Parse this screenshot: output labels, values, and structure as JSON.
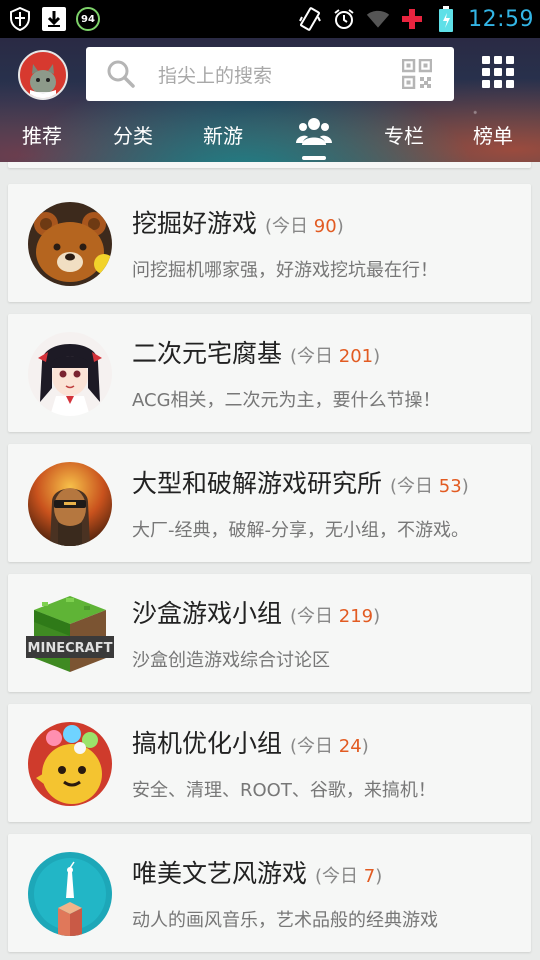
{
  "status_bar": {
    "time": "12:59",
    "notification_badge": "94",
    "icons": [
      "shield-icon",
      "download-icon",
      "badge-icon",
      "vibrate-icon",
      "alarm-icon",
      "wifi-icon",
      "plus-icon",
      "battery-icon"
    ]
  },
  "header": {
    "search_placeholder": "指尖上的搜索",
    "tabs": [
      {
        "label": "推荐"
      },
      {
        "label": "分类"
      },
      {
        "label": "新游"
      },
      {
        "label": "",
        "icon": "groups-icon",
        "active": true
      },
      {
        "label": "专栏"
      },
      {
        "label": "榜单"
      }
    ]
  },
  "groups": [
    {
      "name": "挖掘好游戏",
      "today_prefix": "(今日",
      "count": "90",
      "today_suffix": ")",
      "desc": "问挖掘机哪家强，好游戏挖坑最在行！",
      "icon": "bear-icon"
    },
    {
      "name": "二次元宅腐基",
      "today_prefix": "(今日",
      "count": "201",
      "today_suffix": ")",
      "desc": "ACG相关，二次元为主，要什么节操！",
      "icon": "anime-girl-icon"
    },
    {
      "name": "大型和破解游戏研究所",
      "today_prefix": "(今日",
      "count": "53",
      "today_suffix": ")",
      "desc": "大厂-经典，破解-分享，无小组，不游戏。",
      "icon": "soldier-icon"
    },
    {
      "name": "沙盒游戏小组",
      "today_prefix": "(今日",
      "count": "219",
      "today_suffix": ")",
      "desc": "沙盒创造游戏综合讨论区",
      "icon": "minecraft-icon",
      "icon_text": "MINECRAFT"
    },
    {
      "name": "搞机优化小组",
      "today_prefix": "(今日",
      "count": "24",
      "today_suffix": ")",
      "desc": "安全、清理、ROOT、谷歌，来搞机！",
      "icon": "cartoon-icon"
    },
    {
      "name": "唯美文艺风游戏",
      "today_prefix": "(今日",
      "count": "7",
      "today_suffix": ")",
      "desc": "动人的画风音乐，艺术品般的经典游戏",
      "icon": "monument-valley-icon"
    }
  ],
  "colors": {
    "count": "#e25b22",
    "clock": "#33b5e5"
  }
}
